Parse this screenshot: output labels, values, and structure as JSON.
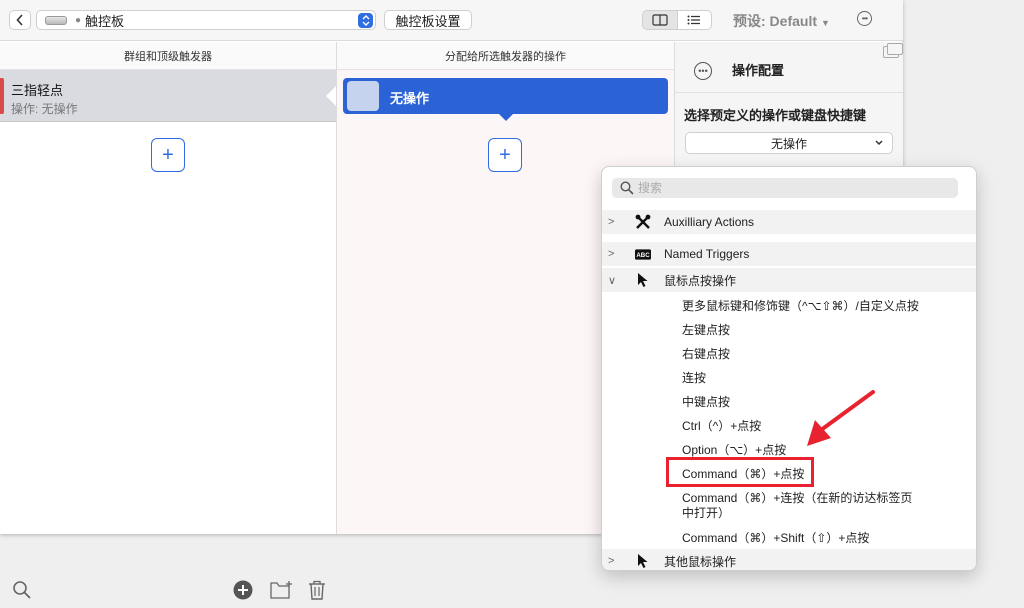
{
  "toolbar": {
    "path_label": "触控板",
    "settings_button": "触控板设置",
    "preset_label": "预设: Default"
  },
  "columns": {
    "groups_header": "群组和顶级触发器",
    "actions_header": "分配给所选触发器的操作"
  },
  "trigger": {
    "title": "三指轻点",
    "subtitle": "操作: 无操作",
    "color": "#d94a4a"
  },
  "action": {
    "label": "无操作",
    "color": "#2b63d6"
  },
  "config": {
    "title": "操作配置",
    "prompt": "选择预定义的操作或键盘快捷键",
    "selected": "无操作"
  },
  "dropdown": {
    "search_placeholder": "搜索",
    "groups": {
      "aux": "Auxilliary Actions",
      "named": "Named Triggers",
      "mouse": "鼠标点按操作",
      "other": "其他鼠标操作"
    },
    "abc_badge": "ABC",
    "items": [
      "更多鼠标键和修饰键（^⌥⇧⌘）/自定义点按",
      "左键点按",
      "右键点按",
      "连按",
      "中键点按",
      "Ctrl（^）+点按",
      "Option（⌥）+点按",
      "Command（⌘）+点按",
      "Command（⌘）+连按（在新的访达标签页",
      "中打开）",
      "Command（⌘）+Shift（⇧）+点按"
    ]
  },
  "annotation": {
    "color": "#e8232f"
  }
}
